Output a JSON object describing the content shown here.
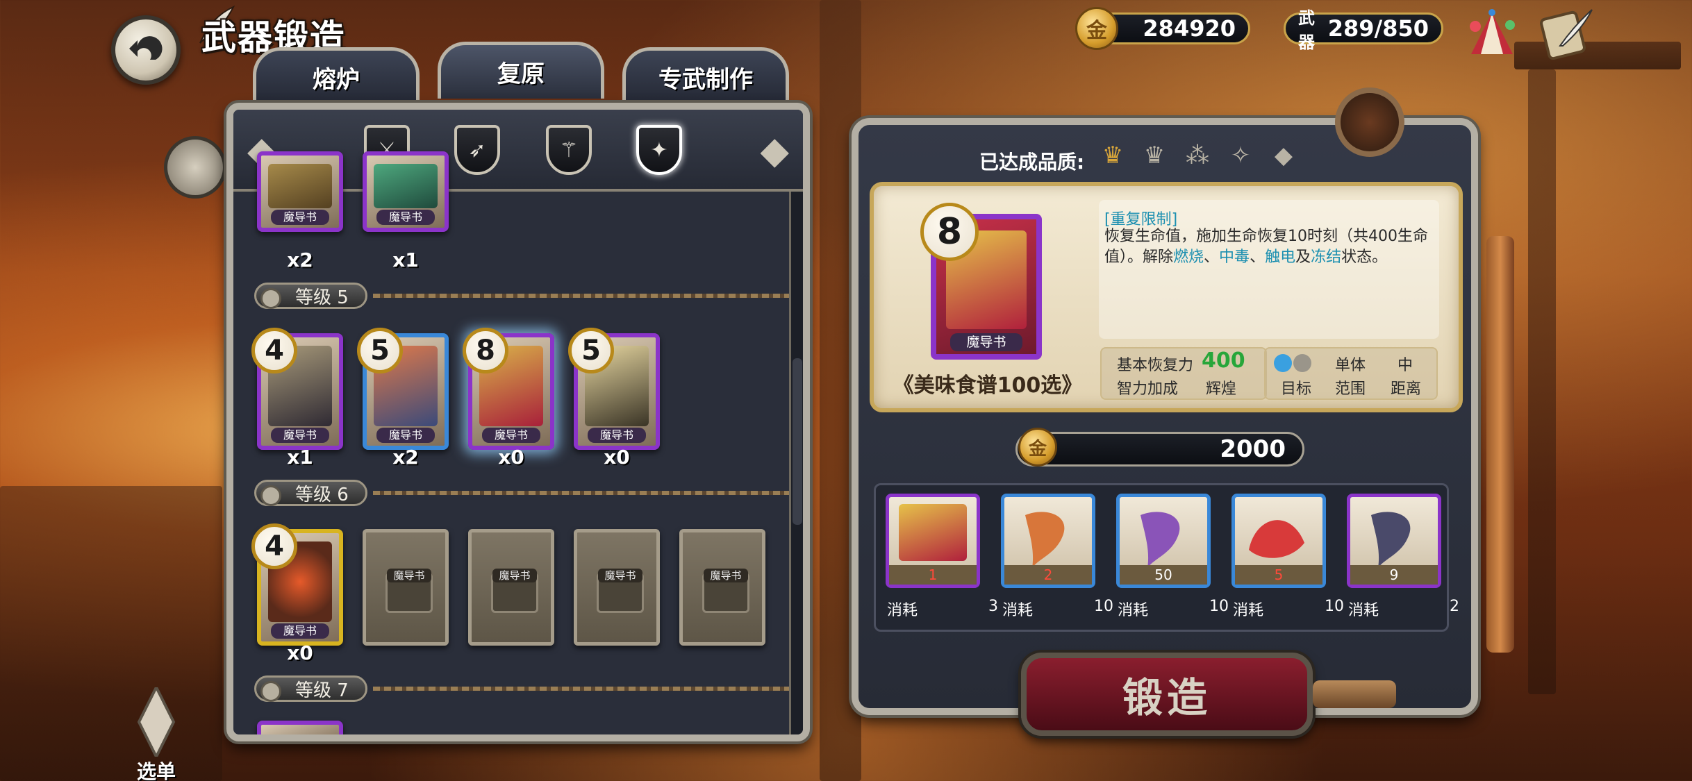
{
  "header": {
    "title": "武器锻造",
    "gold": "284920",
    "weapon_label": "武器",
    "weapon_count": "289/850"
  },
  "tabs": [
    {
      "label": "熔炉",
      "active": false
    },
    {
      "label": "复原",
      "active": true
    },
    {
      "label": "专武制作",
      "active": false
    }
  ],
  "filters": [
    "sword-icon",
    "bow-icon",
    "staff-icon",
    "grimoire-icon"
  ],
  "list": {
    "card_tag": "魔导书",
    "top_counts": [
      "x2",
      "x1"
    ],
    "level5_label": "等级 5",
    "level5_items": [
      {
        "level": "4",
        "count": "x1"
      },
      {
        "level": "5",
        "count": "x2"
      },
      {
        "level": "8",
        "count": "x0"
      },
      {
        "level": "5",
        "count": "x0"
      }
    ],
    "level6_label": "等级 6",
    "level6_items": [
      {
        "level": "4",
        "count": "x0"
      }
    ],
    "level7_label": "等级 7"
  },
  "detail": {
    "quality_label": "已达成品质:",
    "level": "8",
    "card_tag": "魔导书",
    "name": "《美味食谱100选》",
    "limit_tag": "[重复限制]",
    "desc_1": "恢复生命值，施加生命恢复10时刻（共400生命值）。解除",
    "desc_burn": "燃烧",
    "desc_sep1": "、",
    "desc_poison": "中毒",
    "desc_sep2": "、",
    "desc_shock": "触电",
    "desc_and": "及",
    "desc_freeze": "冻结",
    "desc_end": "状态。",
    "stat_base_label": "基本恢复力",
    "stat_base_value": "400",
    "stat_int_label": "智力加成",
    "stat_int_value": "辉煌",
    "target_value": "单体",
    "target_label": "目标",
    "range_label": "范围",
    "distance_value": "中",
    "distance_label": "距离"
  },
  "cost": "2000",
  "materials": [
    {
      "have": "1",
      "label": "消耗",
      "need": "3"
    },
    {
      "have": "2",
      "label": "消耗",
      "need": "10"
    },
    {
      "have": "50",
      "label": "消耗",
      "need": "10"
    },
    {
      "have": "5",
      "label": "消耗",
      "need": "10"
    },
    {
      "have": "9",
      "label": "消耗",
      "need": "2"
    }
  ],
  "forge_label": "锻造",
  "menu_label": "选单",
  "colors": {
    "purple_rarity": "#8b34c9",
    "blue_rarity": "#3a88d8",
    "gold_rarity": "#d8b420",
    "accent_cyan": "#1b8fb0",
    "stat_green": "#27a63a"
  }
}
